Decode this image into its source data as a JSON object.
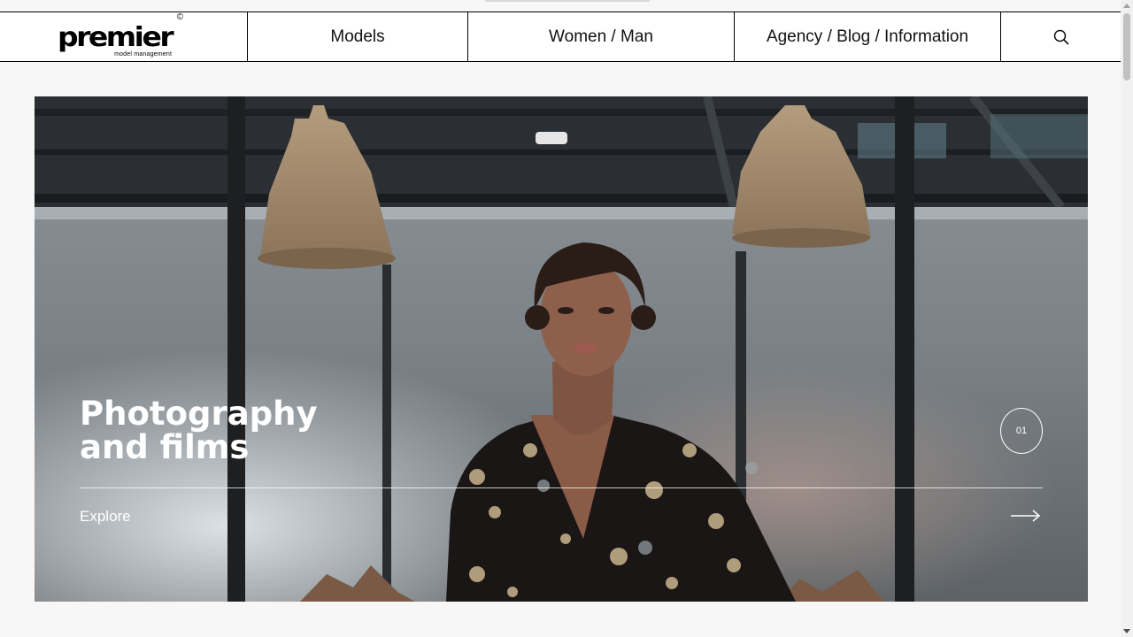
{
  "logo": {
    "wordmark": "premier",
    "tagline": "model management",
    "reg_mark": "©"
  },
  "nav": {
    "models": "Models",
    "women_man": "Women / Man",
    "agency_blog_info": "Agency / Blog / Information",
    "search_icon": "search-icon"
  },
  "hero": {
    "title_line1": "Photography",
    "title_line2": "and films",
    "slide_number": "01",
    "explore_label": "Explore",
    "arrow_icon": "arrow-right-icon"
  },
  "colors": {
    "background": "#f7f7f7",
    "nav_border": "#000000",
    "hero_text": "#ffffff"
  }
}
